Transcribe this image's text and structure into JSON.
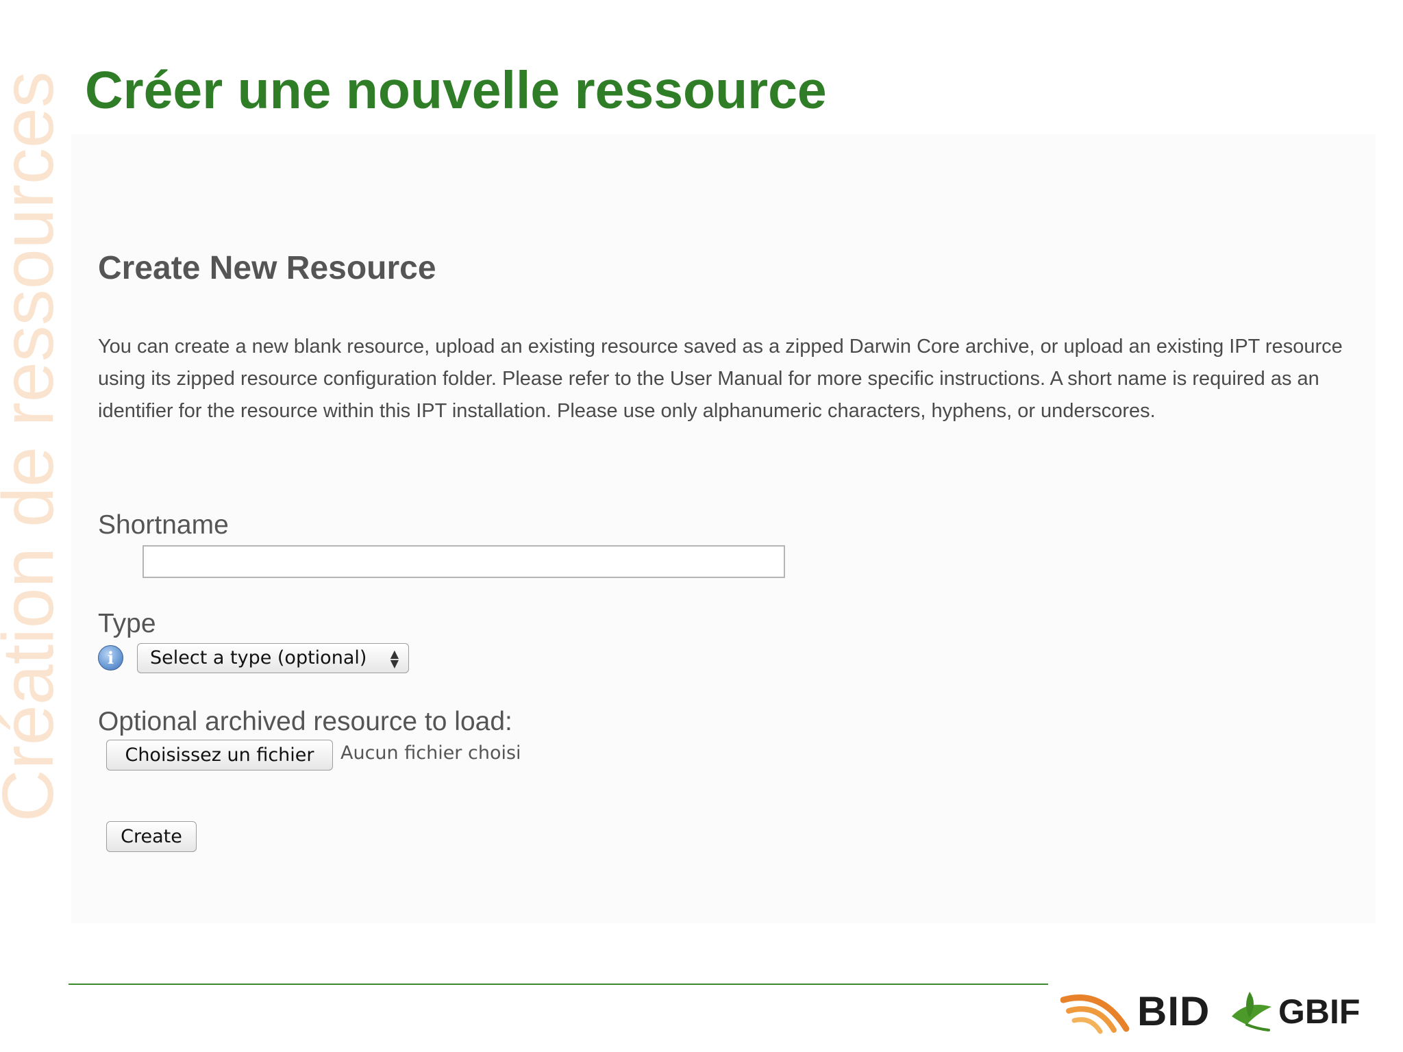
{
  "slide": {
    "side_title": "Création de ressources",
    "title": "Créer une nouvelle ressource"
  },
  "form": {
    "heading": "Create New Resource",
    "intro": "You can create a new blank resource, upload an existing resource saved as a zipped Darwin Core archive, or upload an existing IPT resource using its zipped resource configuration folder. Please refer to the User Manual for more specific instructions. A short name is required as an identifier for the resource within this IPT installation. Please use only alphanumeric characters, hyphens, or underscores.",
    "shortname_label": "Shortname",
    "shortname_value": "",
    "type_label": "Type",
    "type_select_value": "Select a type (optional)",
    "archive_label": "Optional archived resource to load:",
    "file_button_label": "Choisissez un fichier",
    "file_status": "Aucun fichier choisi",
    "create_button_label": "Create"
  },
  "logos": {
    "bid": "BID",
    "gbif": "GBIF"
  },
  "colors": {
    "title_green": "#2f7d26",
    "side_title_peach": "#fbe4cf",
    "footer_rule": "#3c8a2e",
    "bid_orange": "#e8822a",
    "gbif_green": "#4c9a2a"
  }
}
